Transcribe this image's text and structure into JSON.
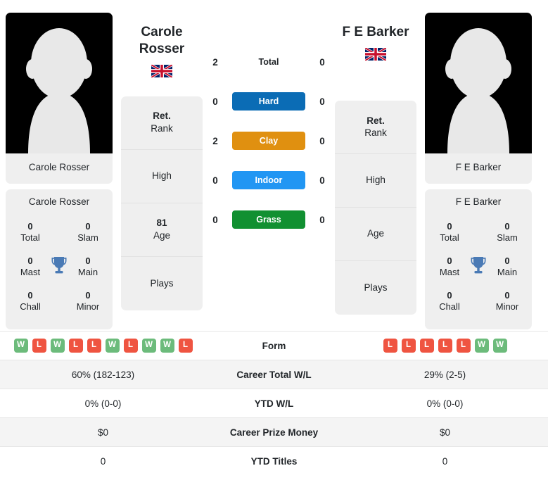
{
  "colors": {
    "hard": "#0b6cb5",
    "clay": "#e09010",
    "indoor": "#2196f3",
    "grass": "#119031",
    "win": "#6cbb7b",
    "loss": "#ef5441",
    "card_bg": "#efefef",
    "row_alt_bg": "#f4f4f4"
  },
  "left_player": {
    "name": "Carole Rosser",
    "name_line1": "Carole",
    "name_line2": "Rosser",
    "flag": "uk-flag-icon",
    "photo_caption": "Carole Rosser",
    "titles_header": "Carole Rosser",
    "titles": [
      {
        "value": "0",
        "label": "Total"
      },
      {
        "value": "0",
        "label": "Slam"
      },
      {
        "value": "0",
        "label": "Mast"
      },
      {
        "value": "0",
        "label": "Main"
      },
      {
        "value": "0",
        "label": "Chall"
      },
      {
        "value": "0",
        "label": "Minor"
      }
    ],
    "info": [
      {
        "value": "Ret.",
        "label": "Rank"
      },
      {
        "value": "",
        "label": "High"
      },
      {
        "value": "81",
        "label": "Age"
      },
      {
        "value": "",
        "label": "Plays"
      }
    ],
    "form": [
      "W",
      "L",
      "W",
      "L",
      "L",
      "W",
      "L",
      "W",
      "W",
      "L"
    ]
  },
  "right_player": {
    "name": "F E Barker",
    "name_line1": "F E Barker",
    "name_line2": "",
    "flag": "uk-flag-icon",
    "photo_caption": "F E Barker",
    "titles_header": "F E Barker",
    "titles": [
      {
        "value": "0",
        "label": "Total"
      },
      {
        "value": "0",
        "label": "Slam"
      },
      {
        "value": "0",
        "label": "Mast"
      },
      {
        "value": "0",
        "label": "Main"
      },
      {
        "value": "0",
        "label": "Chall"
      },
      {
        "value": "0",
        "label": "Minor"
      }
    ],
    "info": [
      {
        "value": "Ret.",
        "label": "Rank"
      },
      {
        "value": "",
        "label": "High"
      },
      {
        "value": "",
        "label": "Age"
      },
      {
        "value": "",
        "label": "Plays"
      }
    ],
    "form": [
      "L",
      "L",
      "L",
      "L",
      "L",
      "W",
      "W"
    ]
  },
  "head_to_head": [
    {
      "label": "Total",
      "chip": false,
      "left": "2",
      "right": "0"
    },
    {
      "label": "Hard",
      "chip": true,
      "left": "0",
      "right": "0",
      "color": "#0b6cb5"
    },
    {
      "label": "Clay",
      "chip": true,
      "left": "2",
      "right": "0",
      "color": "#e09010"
    },
    {
      "label": "Indoor",
      "chip": true,
      "left": "0",
      "right": "0",
      "color": "#2196f3"
    },
    {
      "label": "Grass",
      "chip": true,
      "left": "0",
      "right": "0",
      "color": "#119031"
    }
  ],
  "table": {
    "form_label": "Form",
    "rows": [
      {
        "label": "Career Total W/L",
        "left": "60% (182-123)",
        "right": "29% (2-5)"
      },
      {
        "label": "YTD W/L",
        "left": "0% (0-0)",
        "right": "0% (0-0)"
      },
      {
        "label": "Career Prize Money",
        "left": "$0",
        "right": "$0"
      },
      {
        "label": "YTD Titles",
        "left": "0",
        "right": "0"
      }
    ]
  }
}
